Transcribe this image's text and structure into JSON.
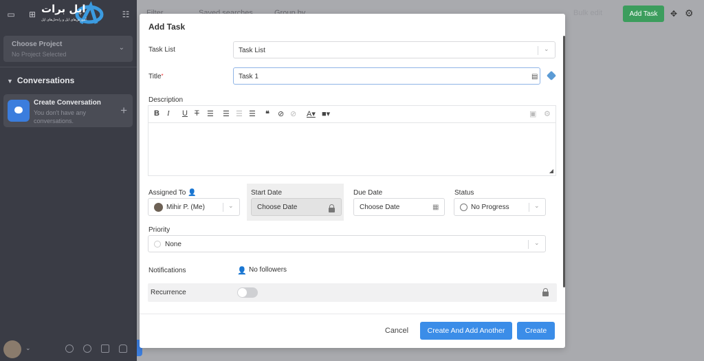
{
  "sidebar": {
    "logo_text": "اپل برات",
    "logo_sub": "آموزش‌های اپل و راه‌حل‌های اپل",
    "project": {
      "title": "Choose Project",
      "subtitle": "No Project Selected"
    },
    "conversations_heading": "Conversations",
    "create_conversation": {
      "title": "Create Conversation",
      "subtitle": "You don't have any conversations."
    }
  },
  "topbar": {
    "filter": "Filter",
    "saved": "Saved searches",
    "group": "Group by",
    "bulk_edit": "Bulk edit",
    "add_task": "Add Task"
  },
  "modal": {
    "title": "Add Task",
    "task_list": {
      "label": "Task List",
      "value": "Task List"
    },
    "title_field": {
      "label": "Title",
      "value": "Task 1"
    },
    "description": {
      "label": "Description"
    },
    "assigned_to": {
      "label": "Assigned To",
      "value": "Mihir P. (Me)"
    },
    "start_date": {
      "label": "Start Date",
      "value": "Choose Date"
    },
    "due_date": {
      "label": "Due Date",
      "value": "Choose Date"
    },
    "status": {
      "label": "Status",
      "value": "No Progress"
    },
    "priority": {
      "label": "Priority",
      "value": "None"
    },
    "notifications": {
      "label": "Notifications",
      "value": "No followers"
    },
    "recurrence": {
      "label": "Recurrence",
      "enabled": false
    },
    "buttons": {
      "cancel": "Cancel",
      "create_another": "Create And Add Another",
      "create": "Create"
    }
  },
  "colors": {
    "primary": "#3b8de8",
    "green": "#3c9d5d",
    "sidebar": "#3a3c45"
  }
}
